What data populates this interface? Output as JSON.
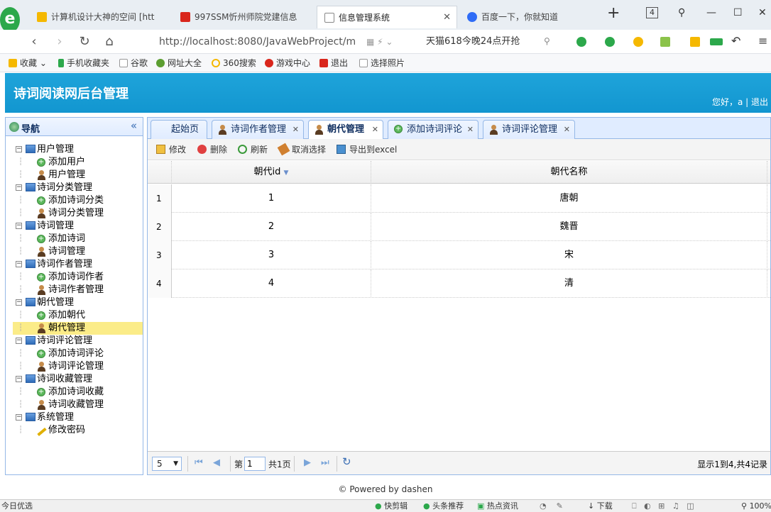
{
  "browser": {
    "tabs": [
      {
        "title": "计算机设计大神的空间 [htt",
        "icon_color": "#f5b800"
      },
      {
        "title": "997SSM忻州师院党建信息",
        "icon_color": "#d9261c"
      },
      {
        "title": "信息管理系统",
        "icon_color": "#888888"
      },
      {
        "title": "百度一下，你就知道",
        "icon_color": "#2f6cf6"
      }
    ],
    "tab_count": "4",
    "url": "http://localhost:8080/JavaWebProject/m",
    "promo": "天猫618今晚24点开抢",
    "bookmarks": [
      "收藏",
      "手机收藏夹",
      "谷歌",
      "网址大全",
      "360搜索",
      "游戏中心",
      "退出",
      "选择照片"
    ]
  },
  "app": {
    "title": "诗词阅读网后台管理",
    "greeting": "您好，a | 退出"
  },
  "sidebar": {
    "title": "导航",
    "tree": [
      {
        "label": "用户管理",
        "type": "group"
      },
      {
        "label": "添加用户",
        "type": "add"
      },
      {
        "label": "用户管理",
        "type": "user"
      },
      {
        "label": "诗词分类管理",
        "type": "group"
      },
      {
        "label": "添加诗词分类",
        "type": "add"
      },
      {
        "label": "诗词分类管理",
        "type": "user"
      },
      {
        "label": "诗词管理",
        "type": "group"
      },
      {
        "label": "添加诗词",
        "type": "add"
      },
      {
        "label": "诗词管理",
        "type": "user"
      },
      {
        "label": "诗词作者管理",
        "type": "group"
      },
      {
        "label": "添加诗词作者",
        "type": "add"
      },
      {
        "label": "诗词作者管理",
        "type": "user"
      },
      {
        "label": "朝代管理",
        "type": "group"
      },
      {
        "label": "添加朝代",
        "type": "add"
      },
      {
        "label": "朝代管理",
        "type": "user",
        "selected": true
      },
      {
        "label": "诗词评论管理",
        "type": "group"
      },
      {
        "label": "添加诗词评论",
        "type": "add"
      },
      {
        "label": "诗词评论管理",
        "type": "user"
      },
      {
        "label": "诗词收藏管理",
        "type": "group"
      },
      {
        "label": "添加诗词收藏",
        "type": "add"
      },
      {
        "label": "诗词收藏管理",
        "type": "user"
      },
      {
        "label": "系统管理",
        "type": "group"
      },
      {
        "label": "修改密码",
        "type": "pencil"
      }
    ]
  },
  "tabs": [
    {
      "label": "起始页",
      "icon": "none"
    },
    {
      "label": "诗词作者管理",
      "icon": "user"
    },
    {
      "label": "朝代管理",
      "icon": "user",
      "active": true
    },
    {
      "label": "添加诗词评论",
      "icon": "add"
    },
    {
      "label": "诗词评论管理",
      "icon": "user"
    }
  ],
  "toolbar": {
    "edit": "修改",
    "delete": "删除",
    "refresh": "刷新",
    "cancel": "取消选择",
    "export": "导出到excel"
  },
  "grid": {
    "columns": [
      "朝代id",
      "朝代名称"
    ],
    "sort_indicator": "▼",
    "rows": [
      {
        "num": "1",
        "id": "1",
        "name": "唐朝"
      },
      {
        "num": "2",
        "id": "2",
        "name": "魏晋"
      },
      {
        "num": "3",
        "id": "3",
        "name": "宋"
      },
      {
        "num": "4",
        "id": "4",
        "name": "清"
      }
    ]
  },
  "pager": {
    "page_size": "5",
    "page_prefix": "第",
    "page_value": "1",
    "page_total": "共1页",
    "status": "显示1到4,共4记录"
  },
  "footer": "© Powered by dashen",
  "statusbar": {
    "left": "今日优选",
    "items": [
      "快剪辑",
      "头条推荐",
      "热点资讯",
      "下载",
      "100%"
    ]
  }
}
